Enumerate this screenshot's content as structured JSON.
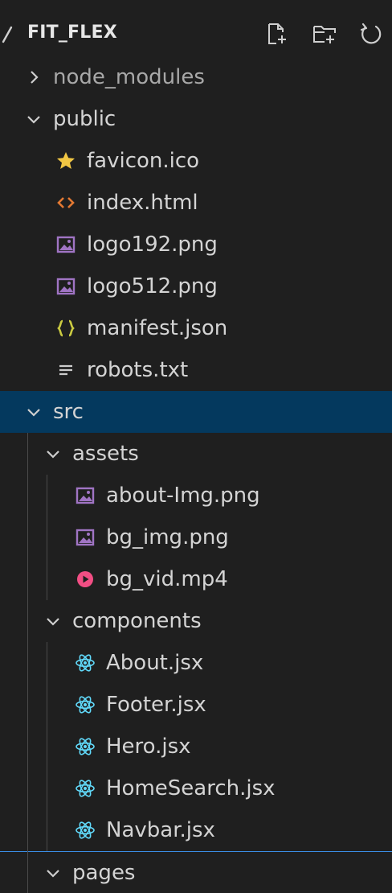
{
  "explorer": {
    "title": "FIT_FLEX",
    "actions": [
      {
        "name": "new-file-icon"
      },
      {
        "name": "new-folder-icon"
      },
      {
        "name": "refresh-icon"
      }
    ]
  },
  "tree": [
    {
      "label": "node_modules",
      "type": "folder",
      "expanded": false,
      "depth": 0
    },
    {
      "label": "public",
      "type": "folder",
      "expanded": true,
      "depth": 0
    },
    {
      "label": "favicon.ico",
      "type": "file",
      "icon": "star-icon",
      "depth": 1
    },
    {
      "label": "index.html",
      "type": "file",
      "icon": "html-icon",
      "depth": 1
    },
    {
      "label": "logo192.png",
      "type": "file",
      "icon": "image-icon",
      "depth": 1
    },
    {
      "label": "logo512.png",
      "type": "file",
      "icon": "image-icon",
      "depth": 1
    },
    {
      "label": "manifest.json",
      "type": "file",
      "icon": "json-icon",
      "depth": 1
    },
    {
      "label": "robots.txt",
      "type": "file",
      "icon": "text-lines-icon",
      "depth": 1
    },
    {
      "label": "src",
      "type": "folder",
      "expanded": true,
      "depth": 0,
      "selected": true
    },
    {
      "label": "assets",
      "type": "folder",
      "expanded": true,
      "depth": 1
    },
    {
      "label": "about-Img.png",
      "type": "file",
      "icon": "image-icon",
      "depth": 2
    },
    {
      "label": "bg_img.png",
      "type": "file",
      "icon": "image-icon",
      "depth": 2
    },
    {
      "label": "bg_vid.mp4",
      "type": "file",
      "icon": "video-icon",
      "depth": 2
    },
    {
      "label": "components",
      "type": "folder",
      "expanded": true,
      "depth": 1
    },
    {
      "label": "About.jsx",
      "type": "file",
      "icon": "react-icon",
      "depth": 2
    },
    {
      "label": "Footer.jsx",
      "type": "file",
      "icon": "react-icon",
      "depth": 2
    },
    {
      "label": "Hero.jsx",
      "type": "file",
      "icon": "react-icon",
      "depth": 2
    },
    {
      "label": "HomeSearch.jsx",
      "type": "file",
      "icon": "react-icon",
      "depth": 2
    },
    {
      "label": "Navbar.jsx",
      "type": "file",
      "icon": "react-icon",
      "depth": 2
    },
    {
      "label": "pages",
      "type": "folder",
      "expanded": true,
      "depth": 1,
      "focused": true
    }
  ],
  "colors": {
    "background": "#1f1f1f",
    "selected_row": "#04395e",
    "focus_border": "#3a8ee6",
    "star": "#f2c744",
    "html": "#e37933",
    "image": "#a074c4",
    "json": "#cbcb41",
    "video": "#f24e84",
    "react": "#61dafb"
  }
}
